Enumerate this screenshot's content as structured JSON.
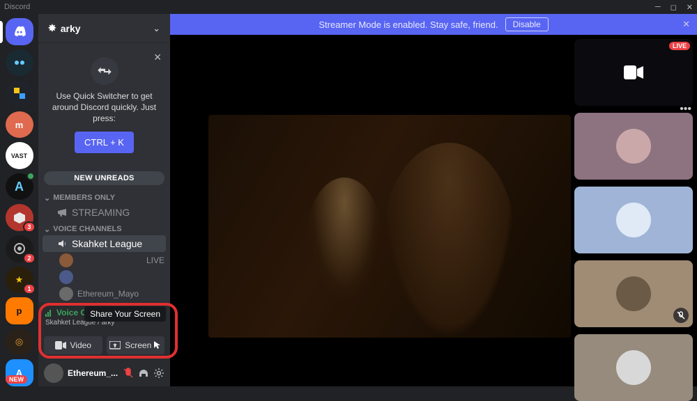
{
  "app": {
    "title": "Discord"
  },
  "banner": {
    "text": "Streamer Mode is enabled. Stay safe, friend.",
    "disable": "Disable"
  },
  "server_header": {
    "name": "arky"
  },
  "servers": [
    {
      "name": "home"
    },
    {
      "name": "server-bot",
      "badge": ""
    },
    {
      "name": "server-puzzle"
    },
    {
      "name": "server-m",
      "letter": "m",
      "bg": "#e06a4f"
    },
    {
      "name": "server-vast",
      "letter": "VAST",
      "bg": "#ffffff",
      "fg": "#222"
    },
    {
      "name": "server-a",
      "status": true
    },
    {
      "name": "server-hex",
      "badge": "3",
      "bg": "#b3362e"
    },
    {
      "name": "server-obs",
      "badge": "2"
    },
    {
      "name": "server-star",
      "badge": "1"
    },
    {
      "name": "server-p",
      "bg": "#ff7a00",
      "letter": "p"
    },
    {
      "name": "server-gears"
    },
    {
      "name": "server-appstore",
      "bg": "#1e90ff"
    }
  ],
  "new_label": "NEW",
  "hintcard": {
    "text": "Use Quick Switcher to get around Discord quickly. Just press:",
    "button": "CTRL + K"
  },
  "new_unreads": "NEW UNREADS",
  "categories": {
    "members_only": "MEMBERS ONLY",
    "streaming_channel": "STREAMING",
    "voice": "VOICE CHANNELS"
  },
  "voice_channel": {
    "name": "Skahket League",
    "live": "LIVE"
  },
  "vc_members": [
    {
      "name": ""
    },
    {
      "name": ""
    },
    {
      "name": "Ethereum_Mayo"
    }
  ],
  "voice_panel": {
    "status": "Voice Connected",
    "sub": "Skahket League / arky",
    "tooltip": "Share Your Screen",
    "video": "Video",
    "screen": "Screen"
  },
  "user_area": {
    "name": "Ethereum_..."
  },
  "tiles": [
    {
      "bg": "#0b0b0f",
      "live": "LIVE",
      "big": true
    },
    {
      "bg": "#8d7280",
      "ava": "#caa8aa"
    },
    {
      "bg": "#9fb4d6",
      "ava": "#dfeaf6"
    },
    {
      "bg": "#a08c74",
      "ava": "#6b5a45",
      "muted": true
    },
    {
      "bg": "#968b7d",
      "ava": "#d8d8d8"
    }
  ]
}
